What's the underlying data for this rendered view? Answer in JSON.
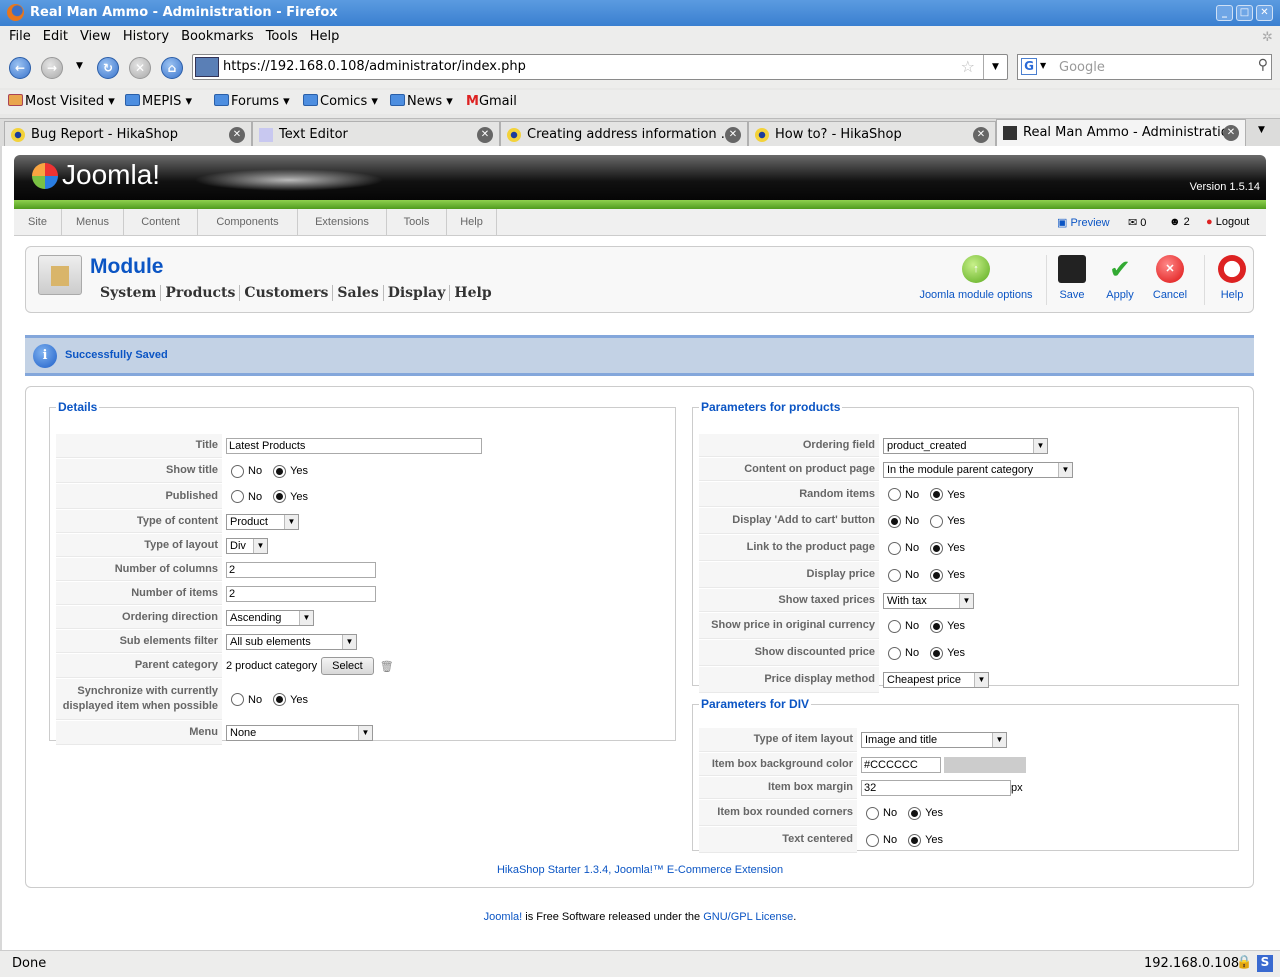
{
  "browser": {
    "title": "Real Man Ammo - Administration - Firefox",
    "menu": [
      "File",
      "Edit",
      "View",
      "History",
      "Bookmarks",
      "Tools",
      "Help"
    ],
    "url": "https://192.168.0.108/administrator/index.php",
    "search_placeholder": "Google",
    "bookmarks": [
      "Most Visited",
      "MEPIS",
      "Forums",
      "Comics",
      "News",
      "Gmail"
    ],
    "tabs": [
      "Bug Report - HikaShop",
      "Text Editor",
      "Creating address information ...",
      "How to? - HikaShop",
      "Real Man Ammo - Administration"
    ],
    "status": "Done",
    "status_host": "192.168.0.108"
  },
  "joomla": {
    "logo": "Joomla!",
    "version": "Version 1.5.14",
    "menu": [
      "Site",
      "Menus",
      "Content",
      "Components",
      "Extensions",
      "Tools",
      "Help"
    ],
    "preview": "Preview",
    "messages": "0",
    "users": "2",
    "logout": "Logout"
  },
  "toolbar": {
    "title": "Module",
    "nav": [
      "System",
      "Products",
      "Customers",
      "Sales",
      "Display",
      "Help"
    ],
    "options": "Joomla module options",
    "save": "Save",
    "apply": "Apply",
    "cancel": "Cancel",
    "help": "Help"
  },
  "message": "Successfully Saved",
  "details": {
    "legend": "Details",
    "rows": [
      {
        "label": "Title",
        "value": "Latest Products"
      },
      {
        "label": "Show title",
        "no": "No",
        "yes": "Yes",
        "selected": "Yes"
      },
      {
        "label": "Published",
        "no": "No",
        "yes": "Yes",
        "selected": "Yes"
      },
      {
        "label": "Type of content",
        "value": "Product"
      },
      {
        "label": "Type of layout",
        "value": "Div"
      },
      {
        "label": "Number of columns",
        "value": "2"
      },
      {
        "label": "Number of items",
        "value": "2"
      },
      {
        "label": "Ordering direction",
        "value": "Ascending"
      },
      {
        "label": "Sub elements filter",
        "value": "All sub elements"
      },
      {
        "label": "Parent category",
        "value": "2 product category",
        "button": "Select"
      },
      {
        "label": "Synchronize with currently displayed item when possible",
        "no": "No",
        "yes": "Yes",
        "selected": "Yes"
      },
      {
        "label": "Menu",
        "value": "None"
      }
    ]
  },
  "products": {
    "legend": "Parameters for products",
    "rows": [
      {
        "label": "Ordering field",
        "value": "product_created"
      },
      {
        "label": "Content on product page",
        "value": "In the module parent category"
      },
      {
        "label": "Random items",
        "no": "No",
        "yes": "Yes",
        "selected": "Yes"
      },
      {
        "label": "Display 'Add to cart' button",
        "no": "No",
        "yes": "Yes",
        "selected": "No"
      },
      {
        "label": "Link to the product page",
        "no": "No",
        "yes": "Yes",
        "selected": "Yes"
      },
      {
        "label": "Display price",
        "no": "No",
        "yes": "Yes",
        "selected": "Yes"
      },
      {
        "label": "Show taxed prices",
        "value": "With tax"
      },
      {
        "label": "Show price in original currency",
        "no": "No",
        "yes": "Yes",
        "selected": "Yes"
      },
      {
        "label": "Show discounted price",
        "no": "No",
        "yes": "Yes",
        "selected": "Yes"
      },
      {
        "label": "Price display method",
        "value": "Cheapest price"
      }
    ]
  },
  "div": {
    "legend": "Parameters for DIV",
    "rows": [
      {
        "label": "Type of item layout",
        "value": "Image and title"
      },
      {
        "label": "Item box background color",
        "value": "#CCCCCC",
        "swatch": "#cccccc"
      },
      {
        "label": "Item box margin",
        "value": "32",
        "unit": "px"
      },
      {
        "label": "Item box rounded corners",
        "no": "No",
        "yes": "Yes",
        "selected": "Yes"
      },
      {
        "label": "Text centered",
        "no": "No",
        "yes": "Yes",
        "selected": "Yes"
      }
    ]
  },
  "footer": {
    "hika": "HikaShop Starter 1.3.4, Joomla!™ E-Commerce Extension",
    "joomla": "Joomla!",
    "mid": " is Free Software released under the ",
    "license": "GNU/GPL License",
    "end": "."
  }
}
